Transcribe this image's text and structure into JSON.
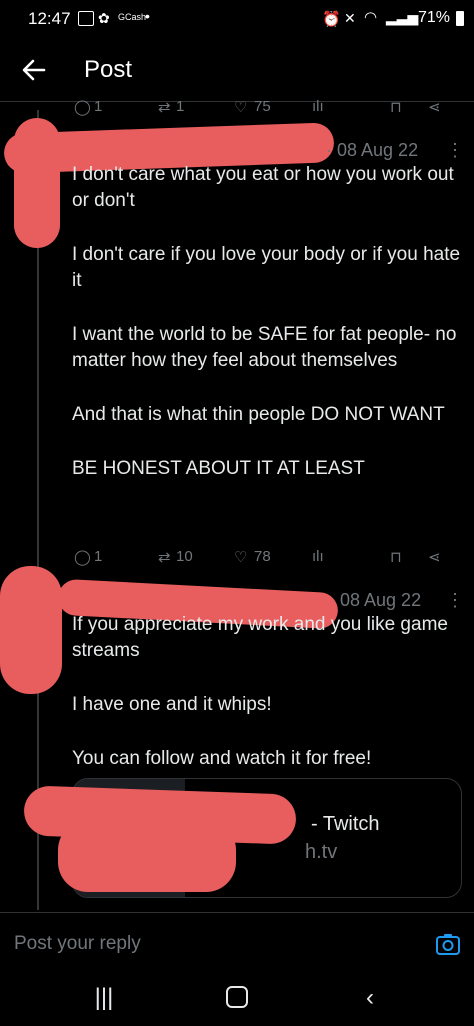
{
  "status_bar": {
    "time": "12:47",
    "battery": "71%"
  },
  "header": {
    "title": "Post"
  },
  "top_actions": {
    "replies": "1",
    "reposts": "1",
    "likes": "75"
  },
  "tweet1": {
    "date": "· 08 Aug 22",
    "paragraphs": [
      "I don't care what you eat or how you work out or don't",
      "I don't care if you love your body or if you hate it",
      "I want the world to be SAFE for fat people- no matter how they feel about themselves",
      "And that is what thin people DO NOT WANT",
      "BE HONEST ABOUT IT AT LEAST"
    ],
    "replies": "1",
    "reposts": "10",
    "likes": "78"
  },
  "tweet2": {
    "date": "08 Aug 22",
    "paragraphs": [
      "If you appreciate my work and you like game streams",
      "I have one and it whips!",
      "You can follow and watch it for free!"
    ],
    "card_title": "- Twitch",
    "card_domain": "h.tv"
  },
  "reply_bar": {
    "placeholder": "Post your reply"
  },
  "colors": {
    "accent": "#1d9bf0",
    "redaction": "#e85d5d",
    "background": "#000000"
  }
}
